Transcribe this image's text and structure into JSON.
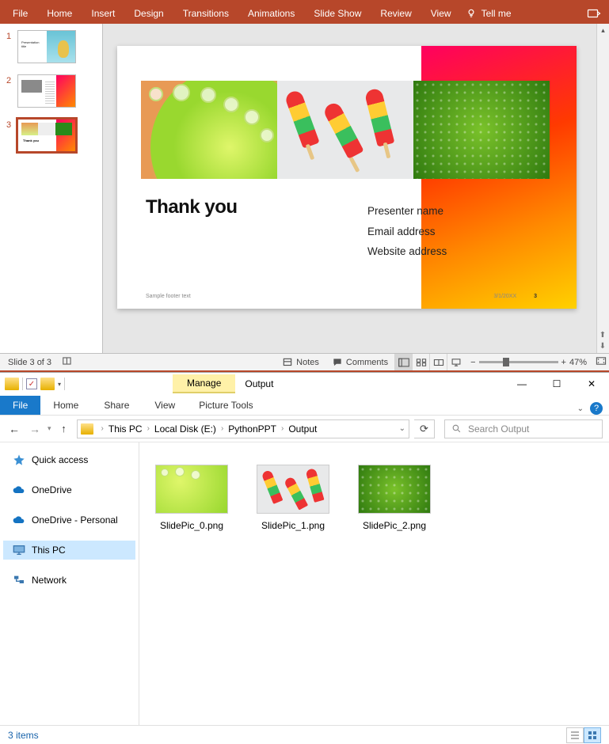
{
  "powerpoint": {
    "ribbon": {
      "tabs": [
        "File",
        "Home",
        "Insert",
        "Design",
        "Transitions",
        "Animations",
        "Slide Show",
        "Review",
        "View"
      ],
      "tell_me": "Tell me"
    },
    "thumbnails": [
      {
        "num": "1",
        "selected": false
      },
      {
        "num": "2",
        "selected": false
      },
      {
        "num": "3",
        "selected": true
      }
    ],
    "slide": {
      "title": "Thank you",
      "presenter": "Presenter name",
      "email": "Email address",
      "website": "Website address",
      "footer_text": "Sample footer text",
      "date": "3/1/20XX",
      "page_num": "3"
    },
    "status": {
      "slide_info": "Slide 3 of 3",
      "notes": "Notes",
      "comments": "Comments",
      "zoom": "47%"
    }
  },
  "explorer": {
    "title": "Output",
    "manage_tab": "Manage",
    "tools_tab": "Picture Tools",
    "menu": {
      "file": "File",
      "home": "Home",
      "share": "Share",
      "view": "View"
    },
    "breadcrumb": [
      "This PC",
      "Local Disk (E:)",
      "PythonPPT",
      "Output"
    ],
    "search_placeholder": "Search Output",
    "sidebar": {
      "quick_access": "Quick access",
      "onedrive": "OneDrive",
      "onedrive_personal": "OneDrive - Personal",
      "this_pc": "This PC",
      "network": "Network"
    },
    "files": [
      {
        "name": "SlidePic_0.png"
      },
      {
        "name": "SlidePic_1.png"
      },
      {
        "name": "SlidePic_2.png"
      }
    ],
    "status_text": "3 items"
  }
}
